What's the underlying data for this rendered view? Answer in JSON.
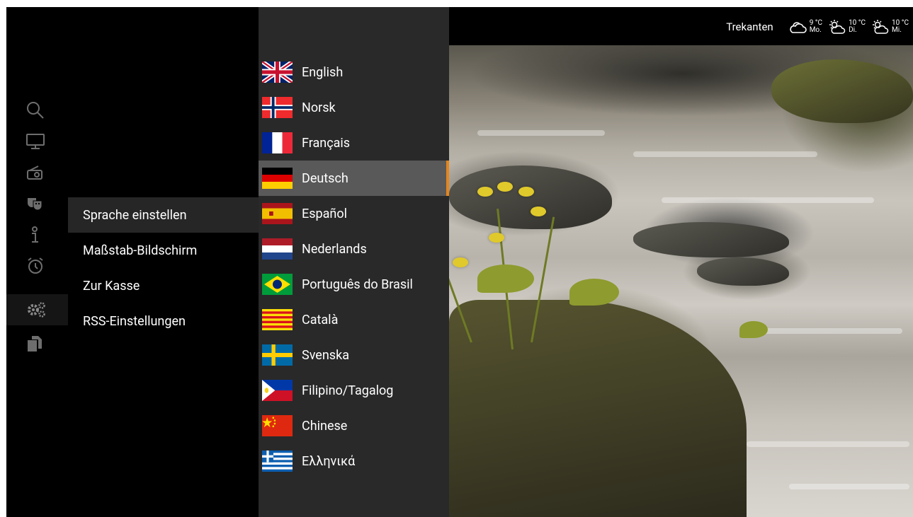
{
  "status_bar": {
    "location": "Trekanten",
    "forecast": [
      {
        "icon": "partly-cloudy-icon",
        "temp": "9 °C",
        "day": "Mo."
      },
      {
        "icon": "sun-cloud-icon",
        "temp": "10 °C",
        "day": "Di."
      },
      {
        "icon": "sun-cloud-icon",
        "temp": "10 °C",
        "day": "Mi."
      }
    ]
  },
  "rail": {
    "items": [
      {
        "icon": "search-icon"
      },
      {
        "icon": "tv-icon"
      },
      {
        "icon": "radio-icon"
      },
      {
        "icon": "theater-masks-icon"
      },
      {
        "icon": "info-icon"
      },
      {
        "icon": "alarm-clock-icon"
      },
      {
        "icon": "settings-gears-icon",
        "active": true
      },
      {
        "icon": "copy-pages-icon"
      }
    ]
  },
  "settings_menu": {
    "items": [
      {
        "label": "Sprache einstellen",
        "selected": true
      },
      {
        "label": "Maßstab-Bildschirm"
      },
      {
        "label": "Zur Kasse"
      },
      {
        "label": "RSS-Einstellungen"
      }
    ]
  },
  "language_menu": {
    "selected_index": 3,
    "accent_color": "#e5861e",
    "items": [
      {
        "label": "English",
        "flag": "uk-flag"
      },
      {
        "label": "Norsk",
        "flag": "norway-flag"
      },
      {
        "label": "Français",
        "flag": "france-flag"
      },
      {
        "label": "Deutsch",
        "flag": "germany-flag"
      },
      {
        "label": "Español",
        "flag": "spain-flag"
      },
      {
        "label": "Nederlands",
        "flag": "netherlands-flag"
      },
      {
        "label": "Português do Brasil",
        "flag": "brazil-flag"
      },
      {
        "label": "Català",
        "flag": "catalonia-flag"
      },
      {
        "label": "Svenska",
        "flag": "sweden-flag"
      },
      {
        "label": "Filipino/Tagalog",
        "flag": "philippines-flag"
      },
      {
        "label": "Chinese",
        "flag": "china-flag"
      },
      {
        "label": "Ελληνικά",
        "flag": "greece-flag"
      }
    ]
  }
}
